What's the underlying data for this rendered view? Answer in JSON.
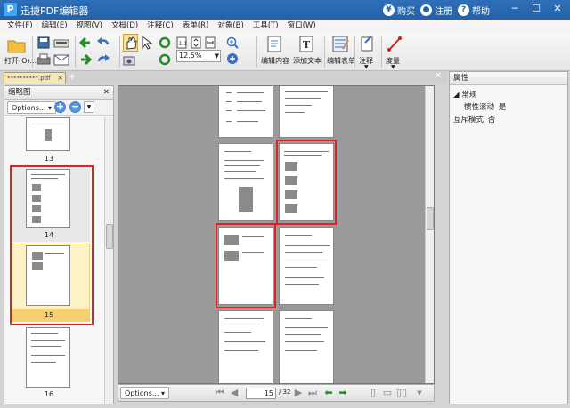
{
  "app": {
    "logo_letter": "P",
    "title": "迅捷PDF编辑器",
    "buy_label": "购买",
    "register_label": "注册",
    "help_label": "帮助"
  },
  "menu": [
    "文件(F)",
    "编辑(E)",
    "视图(V)",
    "文档(D)",
    "注释(C)",
    "表单(R)",
    "对象(B)",
    "工具(T)",
    "窗口(W)"
  ],
  "toolbar": {
    "open_label": "打开(O)...",
    "zoom_value": "12.5%",
    "edit_content_label": "编辑内容",
    "add_text_label": "添加文本",
    "edit_form_label": "编辑表单",
    "annotate_label": "注释",
    "measure_label": "度量"
  },
  "tab": {
    "name": "**********.pdf"
  },
  "thumbnails": {
    "title": "缩略图",
    "options_label": "Options...",
    "pages": [
      "13",
      "14",
      "15",
      "16"
    ],
    "selected_page": "15"
  },
  "status": {
    "options_label": "Options...",
    "current_page": "15",
    "total_pages": "/ 32"
  },
  "properties": {
    "title": "属性",
    "group": "常规",
    "rows": [
      {
        "name": "惯性滚动",
        "value": "是"
      },
      {
        "name": "互斥模式",
        "value": "否"
      }
    ]
  },
  "colors": {
    "titlebar": "#2462a8",
    "selection": "#d22222",
    "tab": "#f6e8b6"
  }
}
